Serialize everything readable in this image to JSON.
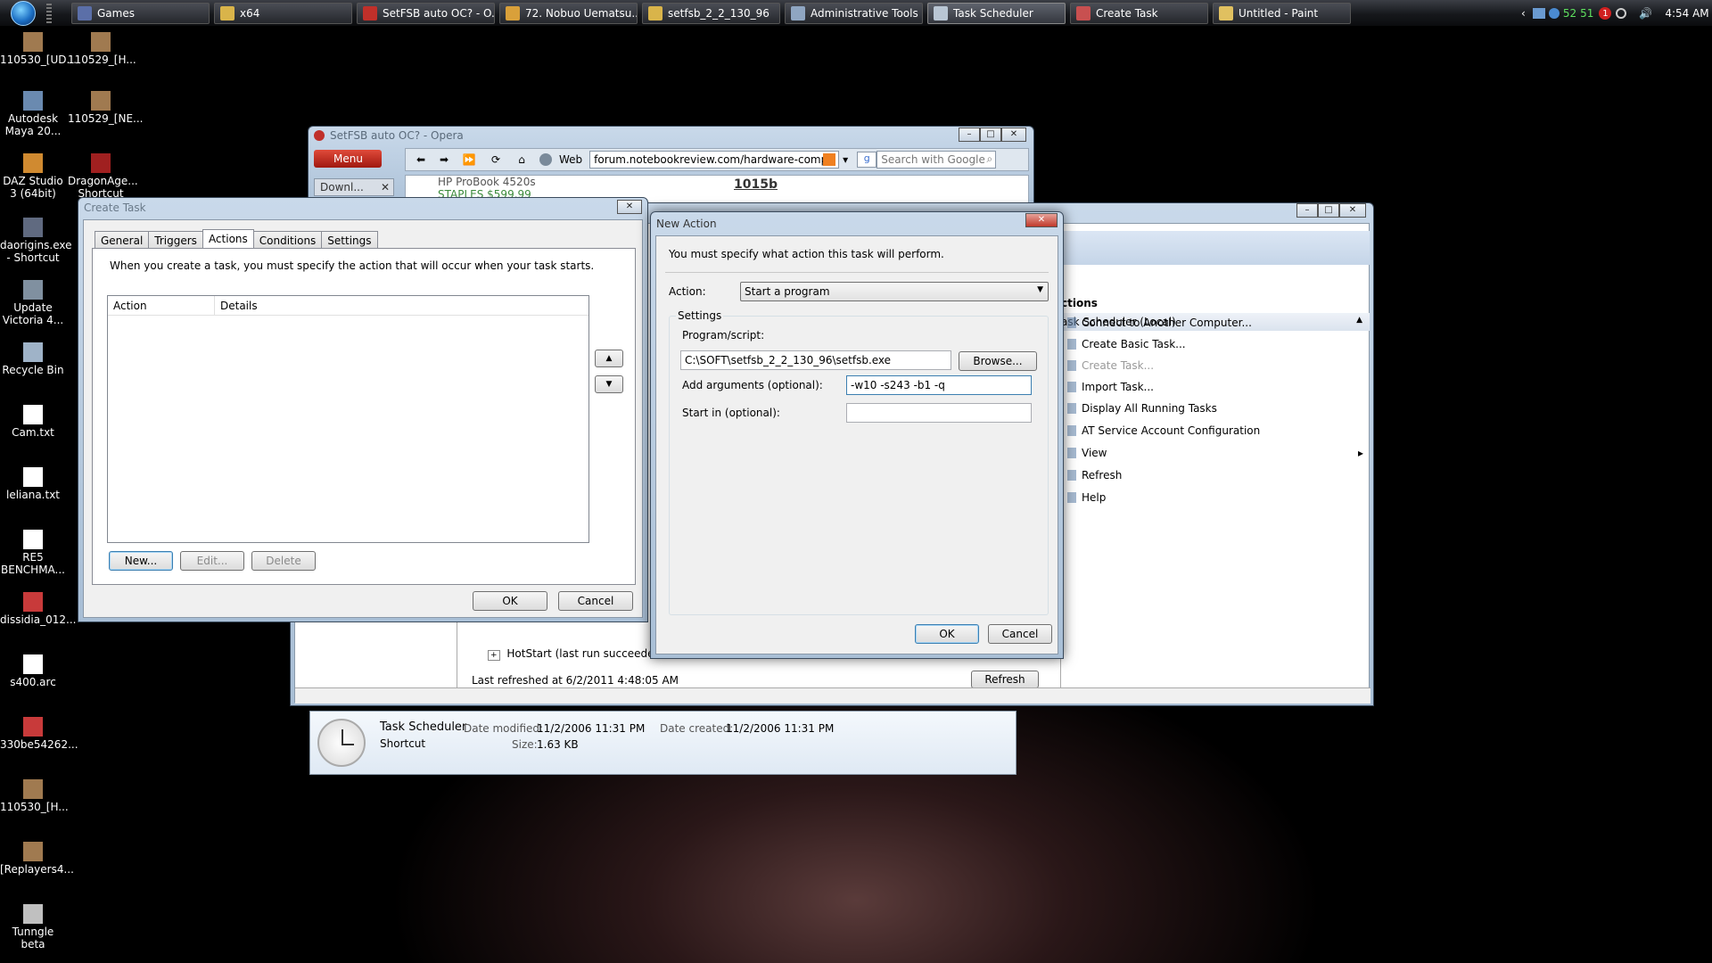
{
  "taskbar": {
    "items": [
      {
        "label": "Games",
        "color": "#5b6fa8"
      },
      {
        "label": "x64",
        "color": "#d9b44a"
      },
      {
        "label": "SetFSB auto OC? - O...",
        "color": "#c0302a"
      },
      {
        "label": "72. Nobuo Uematsu...",
        "color": "#d9a03a"
      },
      {
        "label": "setfsb_2_2_130_96",
        "color": "#d9b44a"
      },
      {
        "label": "Administrative Tools",
        "color": "#8fa6c2"
      },
      {
        "label": "Task Scheduler",
        "color": "#b9c6d4"
      },
      {
        "label": "Create Task",
        "color": "#c85050"
      },
      {
        "label": "Untitled - Paint",
        "color": "#e0c060"
      }
    ],
    "tray": {
      "nums_a": "52",
      "nums_b": "51",
      "badge": "1",
      "clock": "4:54 AM"
    }
  },
  "desktop": {
    "icons": [
      {
        "label": "110530_[UD...",
        "color": "#a07a50"
      },
      {
        "label": "110529_[H...",
        "color": "#a07a50"
      },
      {
        "label": "Autodesk Maya 20...",
        "color": "#6a8ab0"
      },
      {
        "label": "110529_[NE...",
        "color": "#a07a50"
      },
      {
        "label": "DAZ Studio 3 (64bit)",
        "color": "#d08a30"
      },
      {
        "label": "DragonAge... Shortcut",
        "color": "#a02020"
      },
      {
        "label": "daorigins.exe - Shortcut",
        "color": "#606a80"
      },
      {
        "label": "Update Victoria 4...",
        "color": "#8090a0"
      },
      {
        "label": "Recycle Bin",
        "color": "#9fb3c8"
      },
      {
        "label": "Cam.txt",
        "color": "#ffffff"
      },
      {
        "label": "leliana.txt",
        "color": "#ffffff"
      },
      {
        "label": "RE5 BENCHMA...",
        "color": "#ffffff"
      },
      {
        "label": "dissidia_012...",
        "color": "#c83a3a"
      },
      {
        "label": "s400.arc",
        "color": "#ffffff"
      },
      {
        "label": "330be54262...",
        "color": "#c83a3a"
      },
      {
        "label": "110530_[H...",
        "color": "#a07a50"
      },
      {
        "label": "[Replayers4...",
        "color": "#a07a50"
      },
      {
        "label": "Tunngle beta",
        "color": "#c0c0c0"
      }
    ]
  },
  "opera": {
    "title": "SetFSB auto OC? - Opera",
    "menu_label": "Menu",
    "web_label": "Web",
    "url": "forum.notebookreview.com/hardware-comp",
    "search_placeholder": "Search with Google",
    "tab_label": "Downl...",
    "page_snippet_a": "HP ProBook 4520s",
    "page_snippet_b": "STAPLES $599.99",
    "page_snippet_c": "1015b"
  },
  "scheduler": {
    "actions_heading": "ctions",
    "scheduler_local": "ask Scheduler (Local)",
    "menu": [
      {
        "label": "Connect to Another Computer...",
        "enabled": true
      },
      {
        "label": "Create Basic Task...",
        "enabled": true
      },
      {
        "label": "Create Task...",
        "enabled": false
      },
      {
        "label": "Import Task...",
        "enabled": true
      },
      {
        "label": "Display All Running Tasks",
        "enabled": true
      },
      {
        "label": "AT Service Account Configuration",
        "enabled": true
      },
      {
        "label": "View",
        "enabled": true
      },
      {
        "label": "Refresh",
        "enabled": true
      },
      {
        "label": "Help",
        "enabled": true
      }
    ],
    "hotstart": "HotStart (last run succeeded at",
    "last_refreshed": "Last refreshed at 6/2/2011 4:48:05 AM",
    "refresh_btn": "Refresh"
  },
  "details_pane": {
    "name": "Task Scheduler",
    "type": "Shortcut",
    "modified_label": "Date modified:",
    "modified_value": "11/2/2006 11:31 PM",
    "created_label": "Date created:",
    "created_value": "11/2/2006 11:31 PM",
    "size_label": "Size:",
    "size_value": "1.63 KB"
  },
  "create_task": {
    "title": "Create Task",
    "tabs": [
      "General",
      "Triggers",
      "Actions",
      "Conditions",
      "Settings"
    ],
    "active_tab": "Actions",
    "instruction": "When you create a task, you must specify the action that will occur when your task starts.",
    "col_action": "Action",
    "col_details": "Details",
    "btn_new": "New...",
    "btn_edit": "Edit...",
    "btn_delete": "Delete",
    "btn_ok": "OK",
    "btn_cancel": "Cancel"
  },
  "new_action": {
    "title": "New Action",
    "instruction": "You must specify what action this task will perform.",
    "action_label": "Action:",
    "action_value": "Start a program",
    "settings_label": "Settings",
    "program_label": "Program/script:",
    "program_value": "C:\\SOFT\\setfsb_2_2_130_96\\setfsb.exe",
    "browse": "Browse...",
    "args_label": "Add arguments (optional):",
    "args_value": "-w10 -s243 -b1 -q",
    "startin_label": "Start in (optional):",
    "startin_value": "",
    "btn_ok": "OK",
    "btn_cancel": "Cancel"
  },
  "colors": {
    "accent": "#3c7fb1",
    "opera_red": "#c0302a"
  }
}
